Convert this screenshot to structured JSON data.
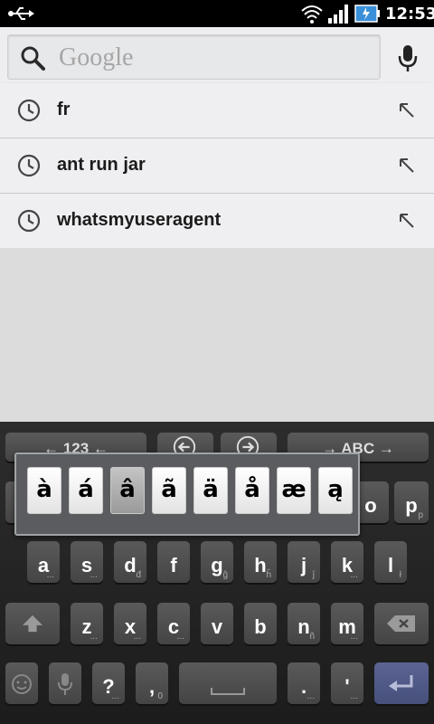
{
  "status": {
    "time": "12:53"
  },
  "search": {
    "placeholder": "Google"
  },
  "suggestions": [
    {
      "text": "fr"
    },
    {
      "text": "ant run jar"
    },
    {
      "text": "whatsmyuseragent"
    }
  ],
  "keyboard": {
    "top_left": "← 123 ←",
    "top_right": "→ ABC →",
    "popup": [
      "à",
      "á",
      "â",
      "ã",
      "ä",
      "å",
      "æ",
      "ą"
    ],
    "popup_selected_index": 2,
    "row1_visible": [
      "o",
      "p"
    ],
    "row1_sub": {
      "p": "p"
    },
    "row2": [
      "a",
      "s",
      "d",
      "f",
      "g",
      "h",
      "j",
      "k",
      "l"
    ],
    "row2_sub": [
      "...",
      "...",
      "đ",
      "",
      "ĝ",
      "ĥ",
      "ĵ",
      "...",
      "ł"
    ],
    "row3": [
      "z",
      "x",
      "c",
      "v",
      "b",
      "n",
      "m"
    ],
    "row3_sub": [
      "...",
      "...",
      "...",
      "",
      "",
      "ñ",
      "..."
    ],
    "row4": {
      "question": "?",
      "comma": ",",
      "period": ".",
      "apostrophe": "'"
    },
    "row4_sub": {
      "question": "...",
      "comma": "0",
      "period": "...",
      "apostrophe": "..."
    },
    "colors": {
      "enter": "#4c5784"
    }
  }
}
